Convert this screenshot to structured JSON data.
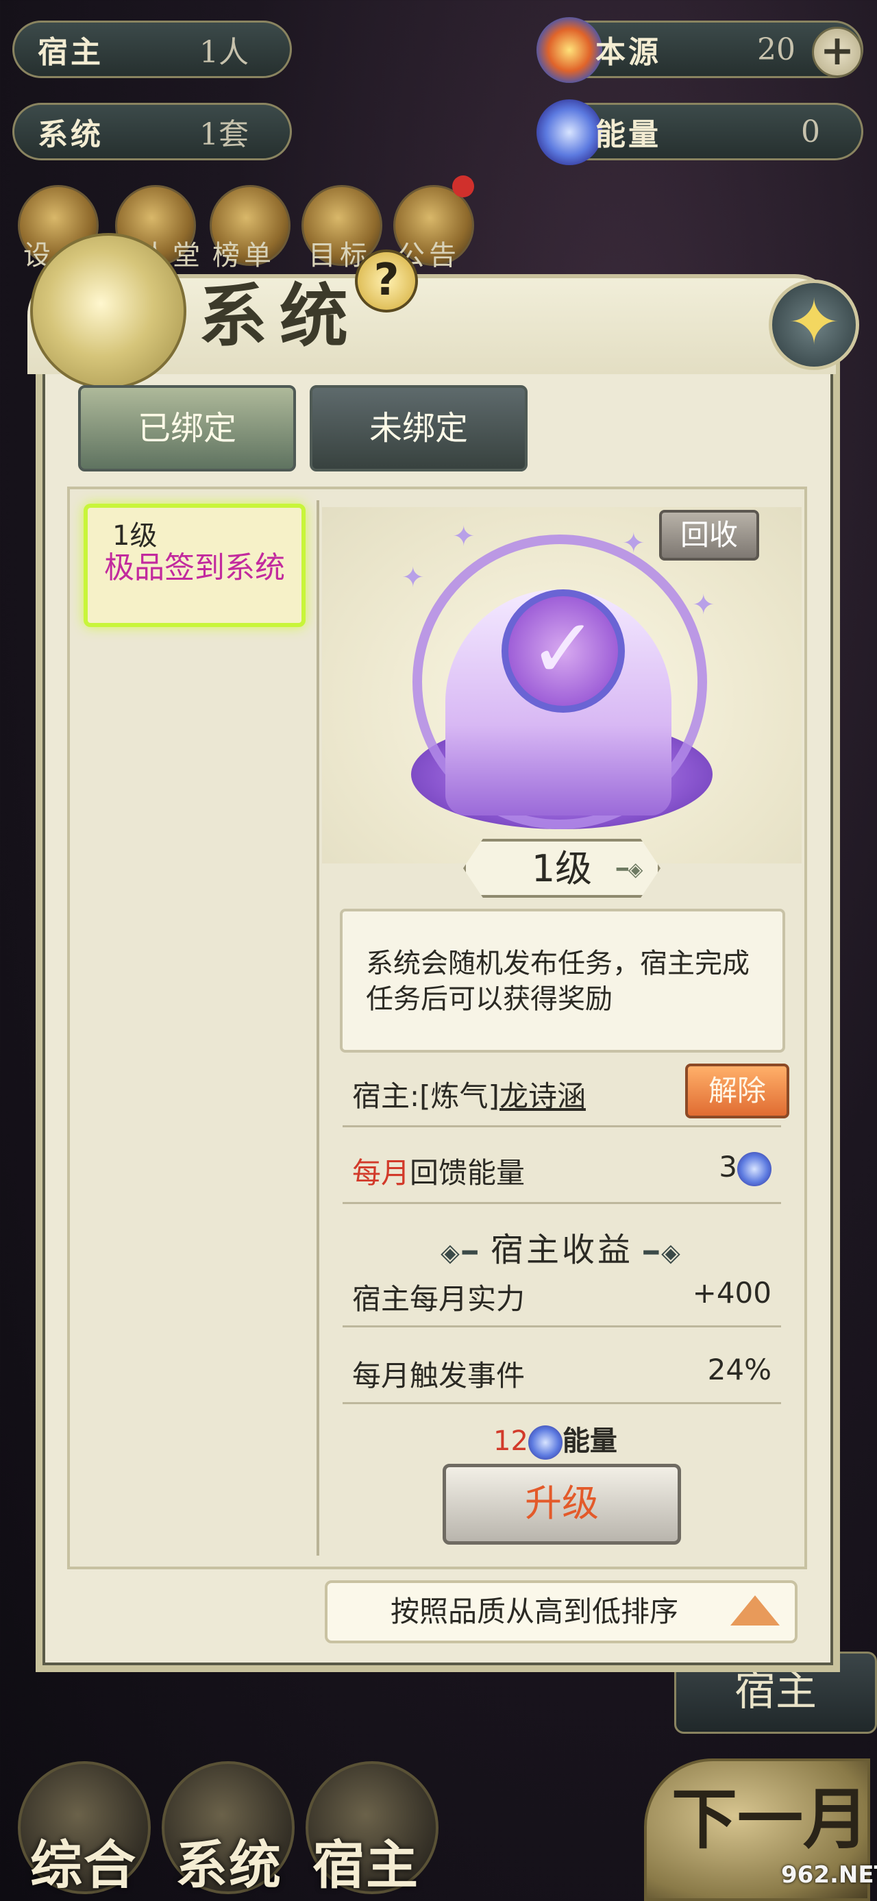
{
  "resources": {
    "host": {
      "label": "宿主",
      "value": "1人"
    },
    "system": {
      "label": "系统",
      "value": "1套"
    },
    "origin": {
      "label": "本源",
      "value": "20",
      "plus": "+"
    },
    "energy": {
      "label": "能量",
      "value": "0"
    }
  },
  "quick_menu": [
    {
      "label": "设"
    },
    {
      "label": "名人堂"
    },
    {
      "label": "榜单"
    },
    {
      "label": "目标"
    },
    {
      "label": "公告"
    }
  ],
  "panel": {
    "title": "系统",
    "help_symbol": "?",
    "close_symbol": "✦",
    "tabs": [
      {
        "label": "已绑定",
        "active": true
      },
      {
        "label": "未绑定",
        "active": false
      }
    ],
    "list": [
      {
        "level": "1级",
        "name": "极品签到系统",
        "selected": true
      }
    ],
    "detail": {
      "recycle_label": "回收",
      "level": "1级",
      "description": "系统会随机发布任务，宿主完成任务后可以获得奖励",
      "host_prefix": "宿主:",
      "host_realm": "[炼气]",
      "host_name": "龙诗涵",
      "release_label": "解除",
      "monthly_energy_highlight": "每月",
      "monthly_energy_label": "回馈能量",
      "monthly_energy_value": "3",
      "section_title": "宿主收益",
      "benefits": [
        {
          "label": "宿主每月实力",
          "value": "+400"
        },
        {
          "label": "每月触发事件",
          "value": "24%"
        }
      ],
      "upgrade_cost": "12",
      "upgrade_cost_unit": "能量",
      "upgrade_label": "升级"
    },
    "sort_label": "按照品质从高到低排序"
  },
  "side_button": {
    "label": "宿主"
  },
  "bottom_nav": [
    {
      "label": "综合"
    },
    {
      "label": "系统"
    },
    {
      "label": "宿主"
    }
  ],
  "next_month": {
    "label": "下一月"
  },
  "watermark": "962.NET"
}
